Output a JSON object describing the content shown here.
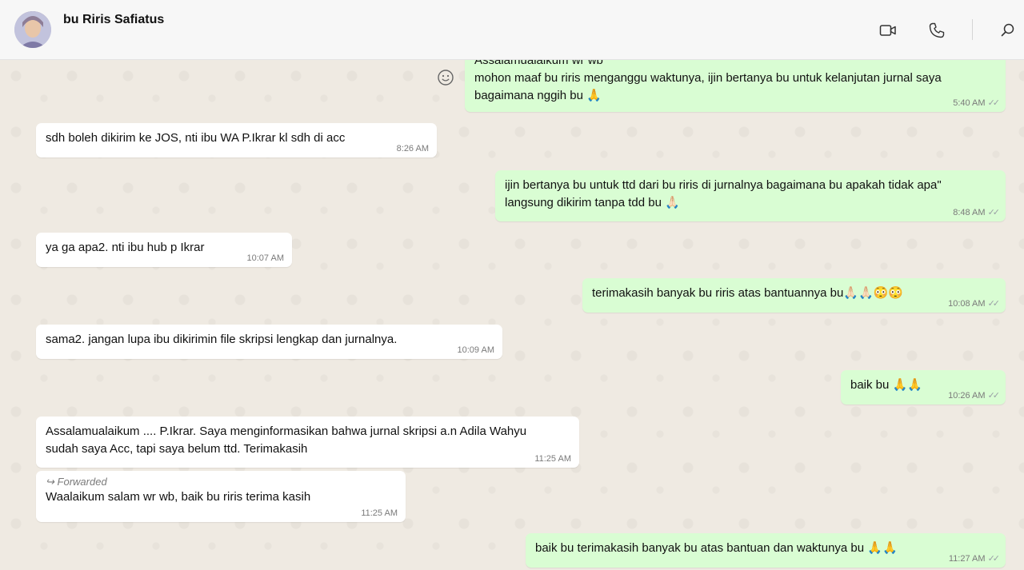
{
  "header": {
    "contact_name": "bu Riris Safiatus",
    "icons": [
      "video-call-icon",
      "voice-call-icon",
      "search-icon"
    ]
  },
  "colors": {
    "incoming_bubble": "#ffffff",
    "outgoing_bubble": "#d9fdd3",
    "chat_background": "#efeae2",
    "header_background": "#f7f7f7"
  },
  "messages": [
    {
      "dir": "out",
      "text": "Assalamualaikum wr wb\nmohon maaf bu riris menganggu waktunya, ijin bertanya bu untuk kelanjutan jurnal saya\nbagaimana nggih bu 🙏",
      "time": "5:40 AM"
    },
    {
      "dir": "in",
      "text": "sdh boleh dikirim ke JOS, nti ibu WA P.Ikrar kl sdh di acc",
      "time": "8:26 AM"
    },
    {
      "dir": "out",
      "text": "ijin bertanya bu untuk ttd dari bu riris di jurnalnya bagaimana bu apakah tidak apa\"\nlangsung dikirim tanpa tdd bu 🙏🏻",
      "time": "8:48 AM"
    },
    {
      "dir": "in",
      "text": "ya ga apa2. nti ibu hub p Ikrar",
      "time": "10:07 AM"
    },
    {
      "dir": "out",
      "text": "terimakasih banyak bu riris atas bantuannya bu🙏🏻🙏🏻😳😳",
      "time": "10:08 AM"
    },
    {
      "dir": "in",
      "text": "sama2. jangan lupa ibu dikirimin file skripsi lengkap dan jurnalnya.",
      "time": "10:09 AM"
    },
    {
      "dir": "out",
      "text": "baik bu 🙏🙏",
      "time": "10:26 AM"
    },
    {
      "dir": "in",
      "text": "Assalamualaikum .... P.Ikrar. Saya menginformasikan bahwa jurnal skripsi a.n Adila Wahyu\nsudah saya Acc, tapi saya belum ttd. Terimakasih",
      "time": "11:25 AM"
    },
    {
      "dir": "in",
      "forwarded_label": "Forwarded",
      "text": "Waalaikum salam wr wb, baik bu riris terima kasih",
      "time": "11:25 AM"
    },
    {
      "dir": "out",
      "text": "baik bu terimakasih banyak bu atas bantuan dan waktunya bu 🙏🙏",
      "time": "11:27 AM"
    }
  ]
}
